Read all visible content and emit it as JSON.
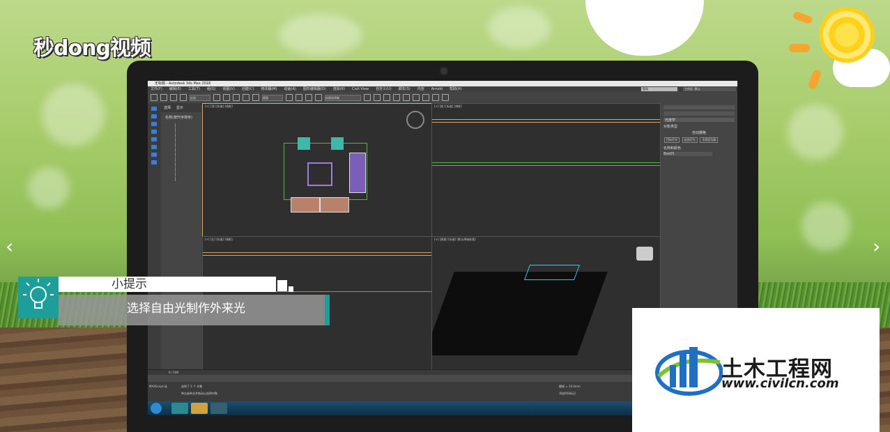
{
  "brand": {
    "logo_text": "秒dong视频"
  },
  "app": {
    "window_title": "无标题 - Autodesk 3ds Max 2018",
    "menu": [
      "文件(F)",
      "编辑(E)",
      "工具(T)",
      "组(G)",
      "视图(V)",
      "创建(C)",
      "修改器(M)",
      "动画(A)",
      "图形编辑器(D)",
      "渲染(R)",
      "Civil View",
      "自定义(U)",
      "脚本(S)",
      "内容",
      "Arnold",
      "帮助(H)"
    ],
    "user_box": "登录",
    "workspace_label": "工作区: 默认",
    "toolbar_select_filter": "全部",
    "toolbar_view": "视图",
    "toolbar_selection_set": "创建选择集",
    "scene_tabs": [
      "选择",
      "显示"
    ],
    "scene_header": "名称(按升序排序)",
    "viewports": [
      {
        "label": "[+] [顶] [标准] [线框]"
      },
      {
        "label": "[+] [前] [标准] [线框]"
      },
      {
        "label": "[+] [左] [标准] [线框]"
      },
      {
        "label": "[+] [透视] [标准] [默认明暗处理]"
      }
    ],
    "command_panel": {
      "dropdown": "光度学",
      "rollout_object_type": "对象类型",
      "auto_grid": "自动栅格",
      "buttons": [
        "目标灯光",
        "自由灯光",
        "太阳定位器"
      ],
      "rollout_name_color": "名称和颜色",
      "object_name": "Box05"
    },
    "timeline": {
      "frame": "0 / 100"
    },
    "status": {
      "selected": "选择了 1 个 对象",
      "prompt": "单击或单击并拖动以选择对象",
      "maxscript": "MAXScript 迷",
      "grid": "栅格 = 10.0mm",
      "add_time_tag": "添加时间标记"
    }
  },
  "tip": {
    "title": "小提示",
    "body": "选择自由光制作外来光"
  },
  "watermark": {
    "name": "土木工程网",
    "url": "www.civilcn.com"
  },
  "colors": {
    "teal": "#1e9e9a",
    "wm_blue": "#1f6fc4",
    "wm_green": "#7cc230"
  }
}
